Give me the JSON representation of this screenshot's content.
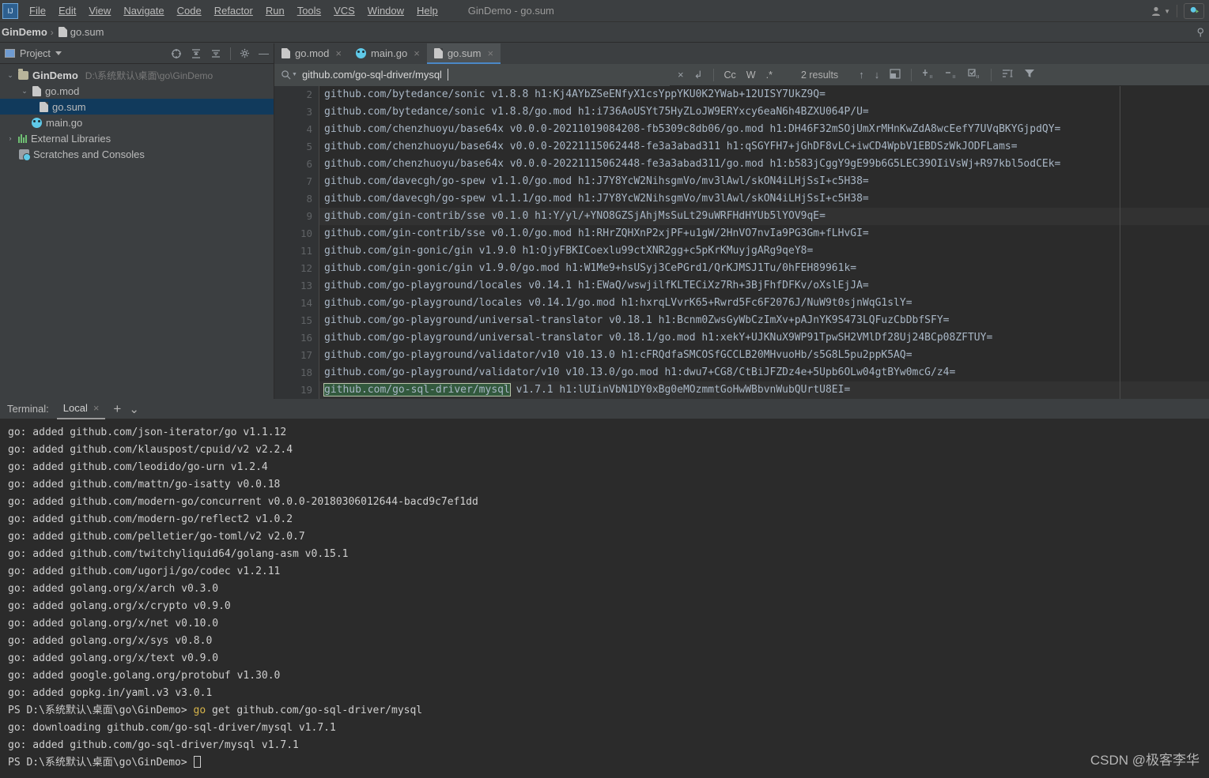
{
  "window": {
    "title": "GinDemo - go.sum"
  },
  "menubar": {
    "items": [
      "File",
      "Edit",
      "View",
      "Navigate",
      "Code",
      "Refactor",
      "Run",
      "Tools",
      "VCS",
      "Window",
      "Help"
    ],
    "logo_label": "IJ",
    "user_icon": "user-avatar-icon",
    "run_icon": "run-configuration-icon"
  },
  "breadcrumb": {
    "project": "GinDemo",
    "separator": "›",
    "file": "go.sum"
  },
  "project_panel": {
    "title": "Project",
    "tools": [
      "locate-icon",
      "expand-all-icon",
      "collapse-all-icon",
      "settings-icon",
      "hide-icon"
    ],
    "tree": [
      {
        "label": "GinDemo",
        "path": "D:\\系统默认\\桌面\\go\\GinDemo",
        "icon": "folder-icon",
        "arrow": "⌄",
        "indent": 0,
        "bold": true,
        "selected": false
      },
      {
        "label": "go.mod",
        "path": "",
        "icon": "file-icon",
        "arrow": "⌄",
        "indent": 1,
        "bold": false,
        "selected": false
      },
      {
        "label": "go.sum",
        "path": "",
        "icon": "file-icon",
        "arrow": "",
        "indent": 2,
        "bold": false,
        "selected": true
      },
      {
        "label": "main.go",
        "path": "",
        "icon": "go-file-icon",
        "arrow": "",
        "indent": 1,
        "bold": false,
        "selected": false
      },
      {
        "label": "External Libraries",
        "path": "",
        "icon": "library-icon",
        "arrow": "›",
        "indent": 0,
        "bold": false,
        "selected": false
      },
      {
        "label": "Scratches and Consoles",
        "path": "",
        "icon": "scratches-icon",
        "arrow": "",
        "indent": 0,
        "bold": false,
        "selected": false
      }
    ]
  },
  "editor": {
    "tabs": [
      {
        "label": "go.mod",
        "icon": "file-icon",
        "active": false,
        "close": "×"
      },
      {
        "label": "main.go",
        "icon": "go-file-icon",
        "active": false,
        "close": "×"
      },
      {
        "label": "go.sum",
        "icon": "file-icon",
        "active": true,
        "close": "×"
      }
    ],
    "search": {
      "icon": "search-icon",
      "value": "github.com/go-sql-driver/mysql",
      "placeholder": "Search",
      "clear_icon": "×",
      "history_icon": "↲",
      "toggles": [
        {
          "name": "match-case-toggle",
          "label": "Cc"
        },
        {
          "name": "words-toggle",
          "label": "W"
        },
        {
          "name": "regex-toggle",
          "label": ".*"
        }
      ],
      "results": "2 results",
      "prev_icon": "↑",
      "next_icon": "↓",
      "open-in-find-window-icon": "❐",
      "add_icon": "+",
      "remove_icon": "−",
      "select_icon": "☑",
      "sort_icon": "≡",
      "filter_icon": "▼"
    },
    "first_visible_line": 2,
    "highlight": "github.com/go-sql-driver/mysql",
    "lines": [
      {
        "n": 2,
        "text": "github.com/bytedance/sonic v1.8.8 h1:Kj4AYbZSeENfyX1csYppYKU0K2YWab+12UISY7UkZ9Q="
      },
      {
        "n": 3,
        "text": "github.com/bytedance/sonic v1.8.8/go.mod h1:i736AoUSYt75HyZLoJW9ERYxcy6eaN6h4BZXU064P/U="
      },
      {
        "n": 4,
        "text": "github.com/chenzhuoyu/base64x v0.0.0-20211019084208-fb5309c8db06/go.mod h1:DH46F32mSOjUmXrMHnKwZdA8wcEefY7UVqBKYGjpdQY="
      },
      {
        "n": 5,
        "text": "github.com/chenzhuoyu/base64x v0.0.0-20221115062448-fe3a3abad311 h1:qSGYFH7+jGhDF8vLC+iwCD4WpbV1EBDSzWkJODFLams="
      },
      {
        "n": 6,
        "text": "github.com/chenzhuoyu/base64x v0.0.0-20221115062448-fe3a3abad311/go.mod h1:b583jCggY9gE99b6G5LEC39OIiVsWj+R97kbl5odCEk="
      },
      {
        "n": 7,
        "text": "github.com/davecgh/go-spew v1.1.0/go.mod h1:J7Y8YcW2NihsgmVo/mv3lAwl/skON4iLHjSsI+c5H38="
      },
      {
        "n": 8,
        "text": "github.com/davecgh/go-spew v1.1.1/go.mod h1:J7Y8YcW2NihsgmVo/mv3lAwl/skON4iLHjSsI+c5H38="
      },
      {
        "n": 9,
        "text": "github.com/gin-contrib/sse v0.1.0 h1:Y/yl/+YNO8GZSjAhjMsSuLt29uWRFHdHYUb5lYOV9qE="
      },
      {
        "n": 10,
        "text": "github.com/gin-contrib/sse v0.1.0/go.mod h1:RHrZQHXnP2xjPF+u1gW/2HnVO7nvIa9PG3Gm+fLHvGI="
      },
      {
        "n": 11,
        "text": "github.com/gin-gonic/gin v1.9.0 h1:OjyFBKICoexlu99ctXNR2gg+c5pKrKMuyjgARg9qeY8="
      },
      {
        "n": 12,
        "text": "github.com/gin-gonic/gin v1.9.0/go.mod h1:W1Me9+hsUSyj3CePGrd1/QrKJMSJ1Tu/0hFEH89961k="
      },
      {
        "n": 13,
        "text": "github.com/go-playground/locales v0.14.1 h1:EWaQ/wswjilfKLTECiXz7Rh+3BjFhfDFKv/oXslEjJA="
      },
      {
        "n": 14,
        "text": "github.com/go-playground/locales v0.14.1/go.mod h1:hxrqLVvrK65+Rwrd5Fc6F2076J/NuW9t0sjnWqG1slY="
      },
      {
        "n": 15,
        "text": "github.com/go-playground/universal-translator v0.18.1 h1:Bcnm0ZwsGyWbCzImXv+pAJnYK9S473LQFuzCbDbfSFY="
      },
      {
        "n": 16,
        "text": "github.com/go-playground/universal-translator v0.18.1/go.mod h1:xekY+UJKNuX9WP91TpwSH2VMlDf28Uj24BCp08ZFTUY="
      },
      {
        "n": 17,
        "text": "github.com/go-playground/validator/v10 v10.13.0 h1:cFRQdfaSMCOSfGCCLB20MHvuoHb/s5G8L5pu2ppK5AQ="
      },
      {
        "n": 18,
        "text": "github.com/go-playground/validator/v10 v10.13.0/go.mod h1:dwu7+CG8/CtBiJFZDz4e+5Upb6OLw04gtBYw0mcG/z4="
      },
      {
        "n": 19,
        "text": "github.com/go-sql-driver/mysql v1.7.1 h1:lUIinVbN1DY0xBg0eMOzmmtGoHwWBbvnWubQUrtU8EI="
      }
    ]
  },
  "terminal": {
    "label": "Terminal:",
    "tab": "Local",
    "close_icon": "×",
    "add_icon": "+",
    "chevron_icon": "⌄",
    "lines": [
      "go: added github.com/json-iterator/go v1.1.12",
      "go: added github.com/klauspost/cpuid/v2 v2.2.4",
      "go: added github.com/leodido/go-urn v1.2.4",
      "go: added github.com/mattn/go-isatty v0.0.18",
      "go: added github.com/modern-go/concurrent v0.0.0-20180306012644-bacd9c7ef1dd",
      "go: added github.com/modern-go/reflect2 v1.0.2",
      "go: added github.com/pelletier/go-toml/v2 v2.0.7",
      "go: added github.com/twitchyliquid64/golang-asm v0.15.1",
      "go: added github.com/ugorji/go/codec v1.2.11",
      "go: added golang.org/x/arch v0.3.0",
      "go: added golang.org/x/crypto v0.9.0",
      "go: added golang.org/x/net v0.10.0",
      "go: added golang.org/x/sys v0.8.0",
      "go: added golang.org/x/text v0.9.0",
      "go: added google.golang.org/protobuf v1.30.0",
      "go: added gopkg.in/yaml.v3 v3.0.1"
    ],
    "prompt_1": {
      "prefix": "PS D:\\系统默认\\桌面\\go\\GinDemo> ",
      "cmd_kw": "go",
      "cmd_rest": " get github.com/go-sql-driver/mysql"
    },
    "post_lines": [
      "go: downloading github.com/go-sql-driver/mysql v1.7.1",
      "go: added github.com/go-sql-driver/mysql v1.7.1"
    ],
    "prompt_2": "PS D:\\系统默认\\桌面\\go\\GinDemo> "
  },
  "watermark": "CSDN @极客李华",
  "colors": {
    "bg_chrome": "#3c3f41",
    "bg_editor": "#2b2b2b",
    "accent_tab": "#4a88c7",
    "selection": "#113a5c",
    "search_highlight": "#32593d",
    "text": "#bbbbbb",
    "code_text": "#a9b7c6"
  }
}
